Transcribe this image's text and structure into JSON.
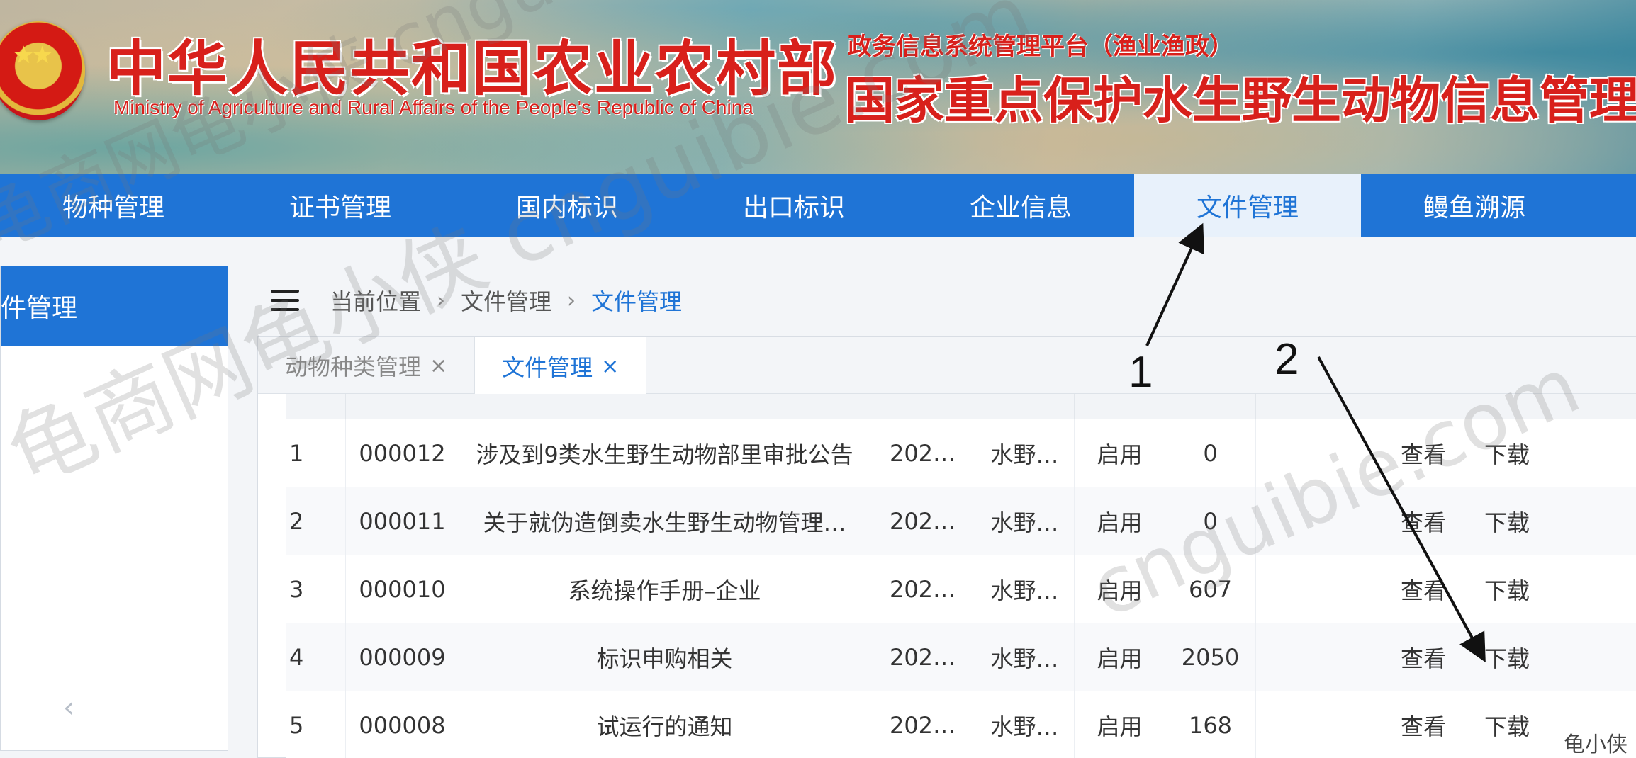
{
  "header": {
    "ministry_cn": "中华人民共和国农业农村部",
    "ministry_en": "Ministry of Agriculture and Rural Affairs of the People's Republic of China",
    "platform_subtitle": "政务信息系统管理平台（渔业渔政）",
    "platform_title": "国家重点保护水生野生动物信息管理"
  },
  "nav": {
    "items": [
      {
        "label": "物种管理"
      },
      {
        "label": "证书管理"
      },
      {
        "label": "国内标识"
      },
      {
        "label": "出口标识"
      },
      {
        "label": "企业信息"
      },
      {
        "label": "文件管理",
        "active": true
      },
      {
        "label": "鳗鱼溯源"
      }
    ]
  },
  "sidebar": {
    "active_item": "件管理",
    "collapse_glyph": "‹"
  },
  "breadcrumb": {
    "items": [
      "当前位置",
      "文件管理",
      "文件管理"
    ],
    "separator": "›"
  },
  "tabs": [
    {
      "label": "动物种类管理",
      "close": "×"
    },
    {
      "label": "文件管理",
      "close": "×",
      "active": true
    }
  ],
  "table": {
    "rows": [
      {
        "idx": "1",
        "code": "000012",
        "name": "涉及到9类水生野生动物部里审批公告",
        "date": "202…",
        "dept": "水野…",
        "status": "启用",
        "count": "0",
        "view": "查看",
        "download": "下载"
      },
      {
        "idx": "2",
        "code": "000011",
        "name": "关于就伪造倒卖水生野生动物管理…",
        "date": "202…",
        "dept": "水野…",
        "status": "启用",
        "count": "0",
        "view": "查看",
        "download": "下载"
      },
      {
        "idx": "3",
        "code": "000010",
        "name": "系统操作手册–企业",
        "date": "202…",
        "dept": "水野…",
        "status": "启用",
        "count": "607",
        "view": "查看",
        "download": "下载"
      },
      {
        "idx": "4",
        "code": "000009",
        "name": "标识申购相关",
        "date": "202…",
        "dept": "水野…",
        "status": "启用",
        "count": "2050",
        "view": "查看",
        "download": "下载"
      },
      {
        "idx": "5",
        "code": "000008",
        "name": "试运行的通知",
        "date": "202…",
        "dept": "水野…",
        "status": "启用",
        "count": "168",
        "view": "查看",
        "download": "下载"
      }
    ]
  },
  "annotations": {
    "label_1": "1",
    "label_2": "2"
  },
  "watermark": {
    "text_a": "龟商网龟小侠 cnguibie.com",
    "text_b": "cnguibie.com",
    "corner": "龟小侠"
  },
  "colors": {
    "nav_blue": "#1f74d6",
    "header_red": "#d8201b"
  }
}
